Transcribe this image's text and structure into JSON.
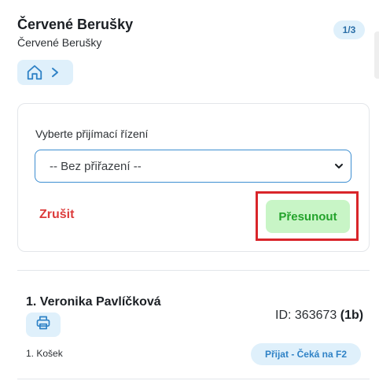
{
  "header": {
    "title": "Červené Berušky",
    "subtitle": "Červené Berušky",
    "page_indicator": "1/3"
  },
  "breadcrumb": {
    "icons": [
      "home-icon",
      "chevron-right-icon"
    ]
  },
  "move_dialog": {
    "select_label": "Vyberte přijímací řízení",
    "select_value": "-- Bez přiřazení --",
    "cancel_label": "Zrušit",
    "move_label": "Přesunout"
  },
  "candidate": {
    "name": "1. Veronika Pavlíčková",
    "id_label": "ID: 363673",
    "id_suffix": "(1b)",
    "basket": "1. Košek",
    "status": "Přijat - Čeká na F2",
    "print_icon": "printer-icon"
  },
  "colors": {
    "accent_bg": "#dff0fb",
    "cancel": "#dc3b3b",
    "move_bg": "#c8f5c6",
    "move_text": "#23a32b",
    "highlight": "#d9252a"
  }
}
